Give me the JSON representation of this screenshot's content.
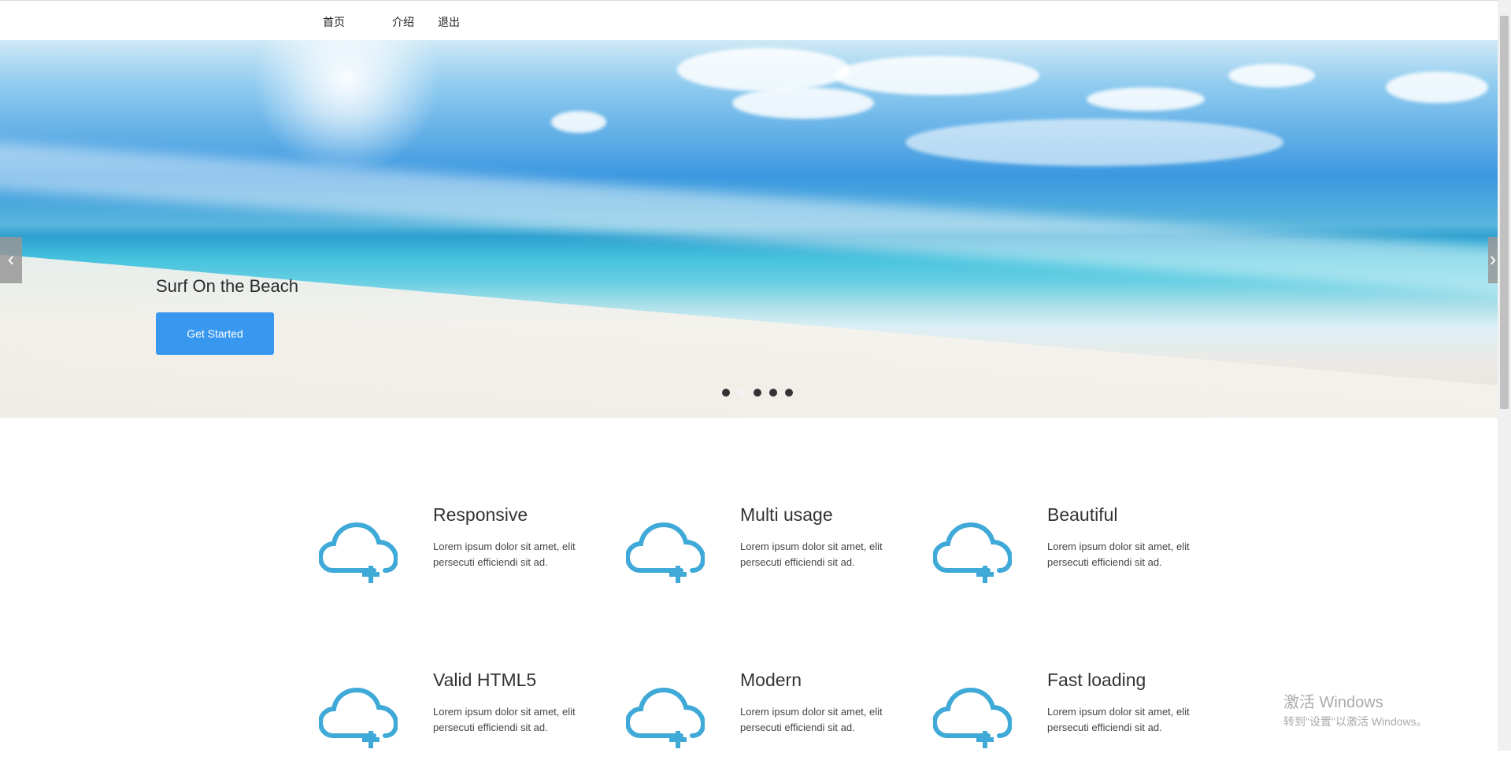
{
  "nav": {
    "items": [
      {
        "label": "首页"
      },
      {
        "label": "介绍"
      },
      {
        "label": "退出"
      }
    ]
  },
  "hero": {
    "title": "Surf On the Beach",
    "button_label": "Get Started",
    "prev_label": "‹",
    "next_label": "›",
    "dots": 5,
    "active_dot": 2
  },
  "features": [
    {
      "title": "Responsive",
      "text": "Lorem ipsum dolor sit amet, elit persecuti efficiendi sit ad.",
      "icon": "cloud-plus-icon"
    },
    {
      "title": "Multi usage",
      "text": "Lorem ipsum dolor sit amet, elit persecuti efficiendi sit ad.",
      "icon": "cloud-plus-icon"
    },
    {
      "title": "Beautiful",
      "text": "Lorem ipsum dolor sit amet, elit persecuti efficiendi sit ad.",
      "icon": "cloud-plus-icon"
    },
    {
      "title": "Valid HTML5",
      "text": "Lorem ipsum dolor sit amet, elit persecuti efficiendi sit ad.",
      "icon": "cloud-plus-icon"
    },
    {
      "title": "Modern",
      "text": "Lorem ipsum dolor sit amet, elit persecuti efficiendi sit ad.",
      "icon": "cloud-plus-icon"
    },
    {
      "title": "Fast loading",
      "text": "Lorem ipsum dolor sit amet, elit persecuti efficiendi sit ad.",
      "icon": "cloud-plus-icon"
    }
  ],
  "colors": {
    "accent": "#3898ef",
    "icon": "#3fa9d8"
  },
  "watermark": {
    "title": "激活 Windows",
    "subtitle": "转到\"设置\"以激活 Windows。"
  }
}
